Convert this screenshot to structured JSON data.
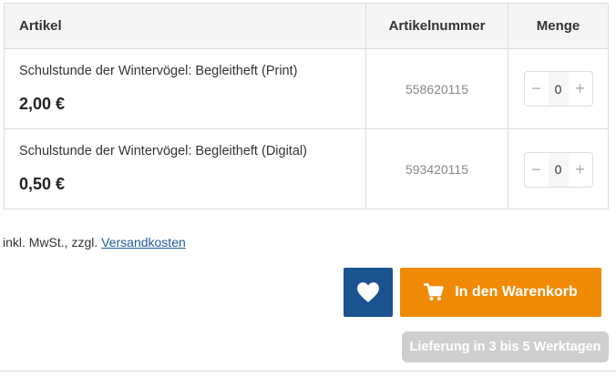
{
  "table": {
    "headers": {
      "article": "Artikel",
      "article_number": "Artikelnummer",
      "quantity": "Menge"
    },
    "rows": [
      {
        "title": "Schulstunde der Wintervögel: Begleitheft (Print)",
        "price": "2,00 €",
        "article_number": "558620115",
        "quantity": "0",
        "minus": "−",
        "plus": "+"
      },
      {
        "title": "Schulstunde der Wintervögel: Begleitheft (Digital)",
        "price": "0,50 €",
        "article_number": "593420115",
        "quantity": "0",
        "minus": "−",
        "plus": "+"
      }
    ]
  },
  "tax_note": {
    "prefix": "inkl. MwSt., zzgl. ",
    "link": "Versandkosten"
  },
  "actions": {
    "wishlist_icon": "heart-icon",
    "cart_icon": "cart-icon",
    "cart_label": "In den Warenkorb"
  },
  "delivery": {
    "label": "Lieferung in 3 bis 5 Werktagen"
  },
  "colors": {
    "wishlist_bg": "#1b5390",
    "cart_bg": "#f08a05",
    "link": "#1f5a99",
    "delivery_bg": "#cfcfcf"
  }
}
